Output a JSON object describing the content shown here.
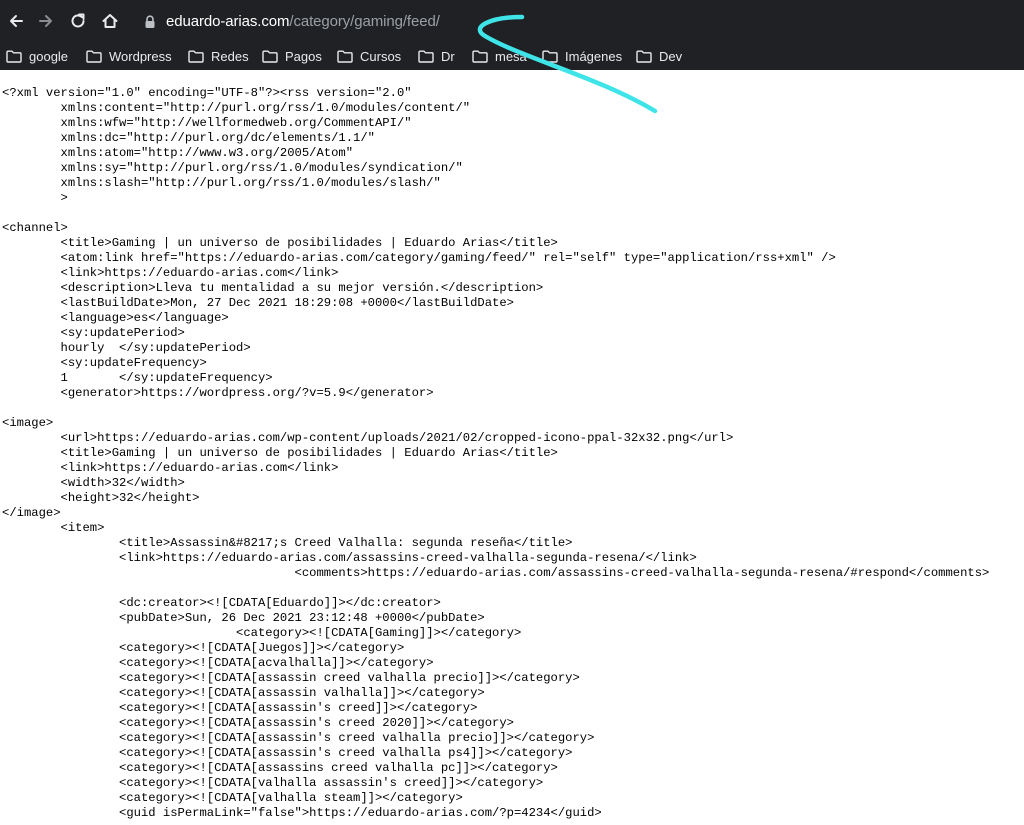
{
  "browser": {
    "url_host": "eduardo-arias.com",
    "url_path": "/category/gaming/feed/",
    "colors": {
      "chrome_bg": "#202124",
      "annotation": "#3fe4e8"
    },
    "toolbar_icons": [
      "back-arrow-icon",
      "forward-arrow-icon",
      "reload-icon",
      "home-icon",
      "lock-icon"
    ]
  },
  "bookmarks": [
    "google",
    "Wordpress",
    "Redes",
    "Pagos",
    "Cursos",
    "Dr",
    "mesa",
    "Imágenes",
    "Dev"
  ],
  "source_lines": [
    "<?xml version=\"1.0\" encoding=\"UTF-8\"?><rss version=\"2.0\"",
    "        xmlns:content=\"http://purl.org/rss/1.0/modules/content/\"",
    "        xmlns:wfw=\"http://wellformedweb.org/CommentAPI/\"",
    "        xmlns:dc=\"http://purl.org/dc/elements/1.1/\"",
    "        xmlns:atom=\"http://www.w3.org/2005/Atom\"",
    "        xmlns:sy=\"http://purl.org/rss/1.0/modules/syndication/\"",
    "        xmlns:slash=\"http://purl.org/rss/1.0/modules/slash/\"",
    "        >",
    "",
    "<channel>",
    "        <title>Gaming | un universo de posibilidades | Eduardo Arias</title>",
    "        <atom:link href=\"https://eduardo-arias.com/category/gaming/feed/\" rel=\"self\" type=\"application/rss+xml\" />",
    "        <link>https://eduardo-arias.com</link>",
    "        <description>Lleva tu mentalidad a su mejor versión.</description>",
    "        <lastBuildDate>Mon, 27 Dec 2021 18:29:08 +0000</lastBuildDate>",
    "        <language>es</language>",
    "        <sy:updatePeriod>",
    "        hourly  </sy:updatePeriod>",
    "        <sy:updateFrequency>",
    "        1       </sy:updateFrequency>",
    "        <generator>https://wordpress.org/?v=5.9</generator>",
    "",
    "<image>",
    "        <url>https://eduardo-arias.com/wp-content/uploads/2021/02/cropped-icono-ppal-32x32.png</url>",
    "        <title>Gaming | un universo de posibilidades | Eduardo Arias</title>",
    "        <link>https://eduardo-arias.com</link>",
    "        <width>32</width>",
    "        <height>32</height>",
    "</image>",
    "        <item>",
    "                <title>Assassin&#8217;s Creed Valhalla: segunda reseña</title>",
    "                <link>https://eduardo-arias.com/assassins-creed-valhalla-segunda-resena/</link>",
    "                                        <comments>https://eduardo-arias.com/assassins-creed-valhalla-segunda-resena/#respond</comments>",
    "",
    "                <dc:creator><![CDATA[Eduardo]]></dc:creator>",
    "                <pubDate>Sun, 26 Dec 2021 23:12:48 +0000</pubDate>",
    "                                <category><![CDATA[Gaming]]></category>",
    "                <category><![CDATA[Juegos]]></category>",
    "                <category><![CDATA[acvalhalla]]></category>",
    "                <category><![CDATA[assassin creed valhalla precio]]></category>",
    "                <category><![CDATA[assassin valhalla]]></category>",
    "                <category><![CDATA[assassin's creed]]></category>",
    "                <category><![CDATA[assassin's creed 2020]]></category>",
    "                <category><![CDATA[assassin's creed valhalla precio]]></category>",
    "                <category><![CDATA[assassin's creed valhalla ps4]]></category>",
    "                <category><![CDATA[assassins creed valhalla pc]]></category>",
    "                <category><![CDATA[valhalla assassin's creed]]></category>",
    "                <category><![CDATA[valhalla steam]]></category>",
    "                <guid isPermaLink=\"false\">https://eduardo-arias.com/?p=4234</guid>"
  ]
}
